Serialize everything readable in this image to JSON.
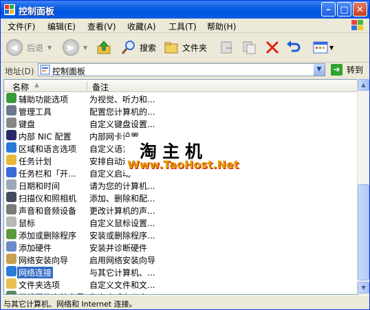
{
  "window": {
    "title": "控制面板"
  },
  "menu": [
    "文件(F)",
    "编辑(E)",
    "查看(V)",
    "收藏(A)",
    "工具(T)",
    "帮助(H)"
  ],
  "toolbar": {
    "back": "后退",
    "search": "搜索",
    "folders": "文件夹"
  },
  "address": {
    "label": "地址(D)",
    "value": "控制面板",
    "go": "转到"
  },
  "columns": {
    "name": "名称",
    "note": "备注"
  },
  "items": [
    {
      "name": "辅助功能选项",
      "desc": "为视觉、听力和...",
      "icon": "accessibility-icon",
      "color": "#3a9a3a"
    },
    {
      "name": "管理工具",
      "desc": "配置您计算机的...",
      "icon": "admin-tools-icon",
      "color": "#6c7a8c"
    },
    {
      "name": "键盘",
      "desc": "自定义键盘设置...",
      "icon": "keyboard-icon",
      "color": "#888888"
    },
    {
      "name": "内部 NIC 配置",
      "desc": "内部网卡设置",
      "icon": "network-card-icon",
      "color": "#2a2a6a"
    },
    {
      "name": "区域和语言选项",
      "desc": "自定义语言",
      "icon": "globe-icon",
      "color": "#2a7ad8"
    },
    {
      "name": "任务计划",
      "desc": "安排自动运",
      "icon": "scheduled-tasks-icon",
      "color": "#e6b93a"
    },
    {
      "name": "任务栏和「开...",
      "desc": "自定义启动",
      "icon": "taskbar-icon",
      "color": "#3a6ad8"
    },
    {
      "name": "日期和时间",
      "desc": "请为您的计算机...",
      "icon": "clock-icon",
      "color": "#9aa8b8"
    },
    {
      "name": "扫描仪和照相机",
      "desc": "添加、删除和配...",
      "icon": "scanner-icon",
      "color": "#444c5c"
    },
    {
      "name": "声音和音频设备",
      "desc": "更改计算机的声...",
      "icon": "speaker-icon",
      "color": "#7a7a7a"
    },
    {
      "name": "鼠标",
      "desc": "自定义鼠标设置...",
      "icon": "mouse-icon",
      "color": "#b8b8b8"
    },
    {
      "name": "添加或删除程序",
      "desc": "安装或删除程序...",
      "icon": "add-remove-icon",
      "color": "#5a9a3a"
    },
    {
      "name": "添加硬件",
      "desc": "安装并诊断硬件",
      "icon": "add-hardware-icon",
      "color": "#6a8ac8"
    },
    {
      "name": "网络安装向导",
      "desc": "启用网络安装向导",
      "icon": "network-wizard-icon",
      "color": "#c8a050"
    },
    {
      "name": "网络连接",
      "desc": "与其它计算机、...",
      "icon": "network-connections-icon",
      "color": "#2a7ad8"
    },
    {
      "name": "文件夹选项",
      "desc": "自定义文件和文...",
      "icon": "folder-options-icon",
      "color": "#e6c050"
    },
    {
      "name": "无线网络安装向导",
      "desc": "为家庭或办公室...",
      "icon": "wireless-icon",
      "color": "#5a8a5a"
    }
  ],
  "selected_index": 14,
  "status": "与其它计算机、网络和 Internet 连接。",
  "watermark": {
    "line1": "淘主机",
    "line2": "Www.TaoHost.Net"
  }
}
